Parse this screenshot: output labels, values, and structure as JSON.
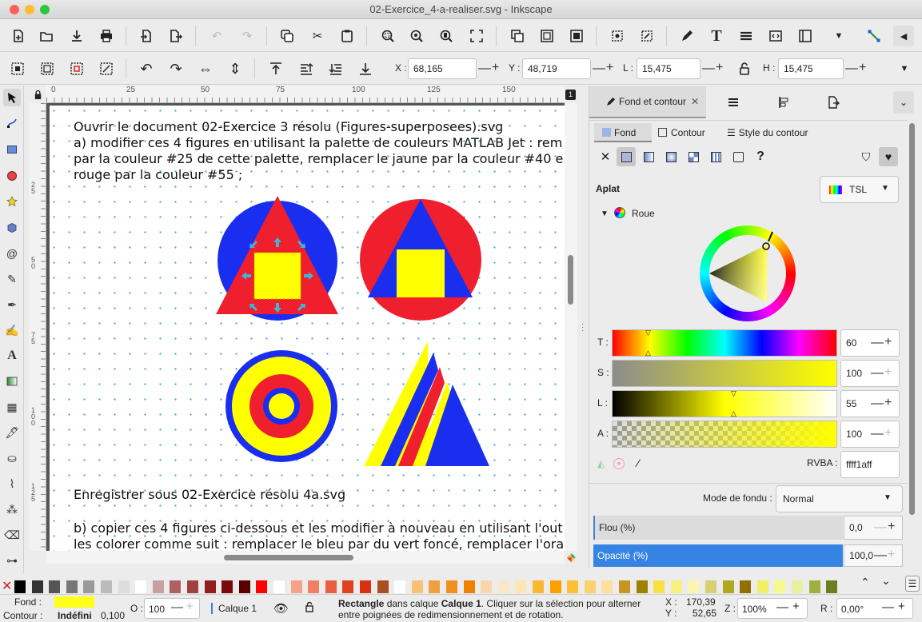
{
  "window": {
    "title": "02-Exercice_4-a-realiser.svg - Inkscape"
  },
  "toolbar": {
    "x_label": "X :",
    "x_value": "68,165",
    "y_label": "Y :",
    "y_value": "48,719",
    "w_label": "L :",
    "w_value": "15,475",
    "h_label": "H :",
    "h_value": "15,475"
  },
  "rulers": {
    "h_ticks": [
      "0",
      "25",
      "50",
      "75",
      "100",
      "125",
      "150"
    ],
    "v_ticks": [
      "2 5",
      "5 0",
      "7 5",
      "1 0 0",
      "1 2 5"
    ]
  },
  "canvas": {
    "text_lines": [
      "Ouvrir le document 02-Exercice 3 résolu (Figures-superposees).svg",
      "a) modifier ces 4 figures en utilisant la palette de couleurs MATLAB Jet : rem",
      "par la couleur #25 de cette palette, remplacer le jaune par la couleur #40 e",
      "rouge par la couleur #55 ;"
    ],
    "save_line": "Enregistrer sous 02-Exercice résolu 4a.svg",
    "b_lines": [
      "b) copier ces 4 figures ci-dessous et les modifier à nouveau en utilisant l'out",
      "les colorer comme suit : remplacer le bleu par du vert foncé, remplacer l'ora"
    ],
    "colors": {
      "blue": "#1a2ef0",
      "red": "#ef1f2e",
      "yellow": "#ffff00",
      "handle": "#3fb6d8"
    }
  },
  "page_badge": "1",
  "panel": {
    "tabs": [
      "Fond et contour"
    ],
    "subtabs": [
      "Fond",
      "Contour",
      "Style du contour"
    ],
    "fill_label": "Aplat",
    "mode_select": "TSL",
    "wheel_label": "Roue",
    "sliders": [
      {
        "label": "T :",
        "value": "60"
      },
      {
        "label": "S :",
        "value": "100"
      },
      {
        "label": "L :",
        "value": "55"
      },
      {
        "label": "A :",
        "value": "100"
      }
    ],
    "rgba_label": "RVBA :",
    "rgba_value": "ffff1aff",
    "blend_label": "Mode de fondu :",
    "blend_value": "Normal",
    "blur_label": "Flou (%)",
    "blur_value": "0,0",
    "opacity_label": "Opacité (%)",
    "opacity_value": "100,0",
    "unknown_label": "?"
  },
  "statusbar": {
    "fill_label": "Fond :",
    "stroke_label": "Contour :",
    "stroke_value": "Indéfini",
    "stroke_width": "0,100",
    "fill_color": "#ffff1a",
    "opacity_label": "O :",
    "opacity_value": "100",
    "layer": "Calque 1",
    "message_bold": "Rectangle",
    "message_mid": " dans calque ",
    "message_layer": "Calque 1",
    "message_rest": ". Cliquer sur la sélection pour alterner",
    "message_line2": "entre poignées de redimensionnement et de rotation.",
    "x_label": "X :",
    "x_value": "170,39",
    "y_label": "Y :",
    "y_value": "52,65",
    "z_label": "Z :",
    "zoom": "100%",
    "r_label": "R :",
    "rotation": "0,00°"
  }
}
